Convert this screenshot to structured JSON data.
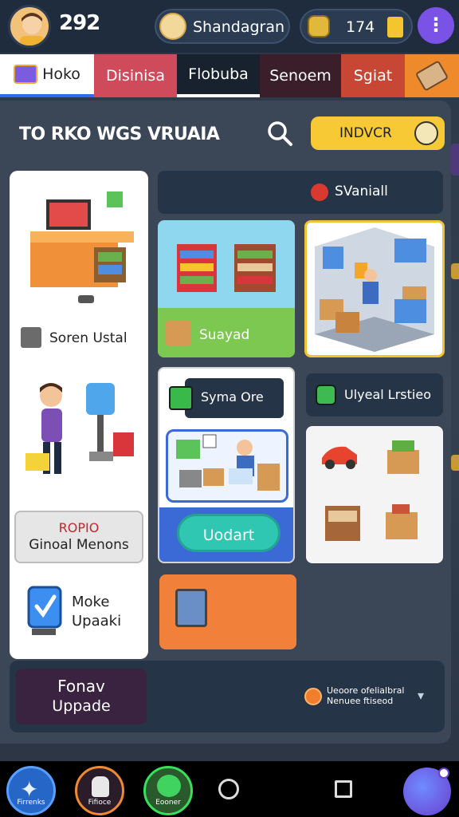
{
  "topbar": {
    "level": "292",
    "store_name": "Shandagran",
    "coins": "174",
    "menu_icon": "menu-icon"
  },
  "tabs": [
    {
      "label": "Hoko"
    },
    {
      "label": "Disinisa"
    },
    {
      "label": "Flobuba"
    },
    {
      "label": "Senoem"
    },
    {
      "label": "Sgiat"
    },
    {
      "label": ""
    }
  ],
  "panel": {
    "title": "TO RKO WGS VRUAIA",
    "index_button": "INDVCR",
    "header_strip_label": "SVaniall"
  },
  "left_column": {
    "label_1": "Soren Ustal",
    "promo_line_1": "ROPIO",
    "promo_line_2": "Ginoal Menons",
    "make_line_1": "Moke",
    "make_line_2": "Upaaki"
  },
  "cards": {
    "shelves_label": "Suayad",
    "sync_label": "Syma Ore",
    "update_button": "Uodart",
    "upload_label": "Ulyeal Lrstieo"
  },
  "bottom_strip": {
    "upgrade_line_1": "Fonav",
    "upgrade_line_2": "Uppade",
    "notice_line_1": "Ueoore ofelialbral",
    "notice_line_2": "Nenuee ftiseod"
  },
  "navbar": {
    "btn1_caption": "Firrenks",
    "btn2_caption": "Fifioce",
    "btn3_caption": "Eooner"
  },
  "colors": {
    "accent_yellow": "#f7c934",
    "accent_teal": "#2fc6b2",
    "accent_blue": "#3b6ad6",
    "panel_bg": "#3b4757"
  }
}
